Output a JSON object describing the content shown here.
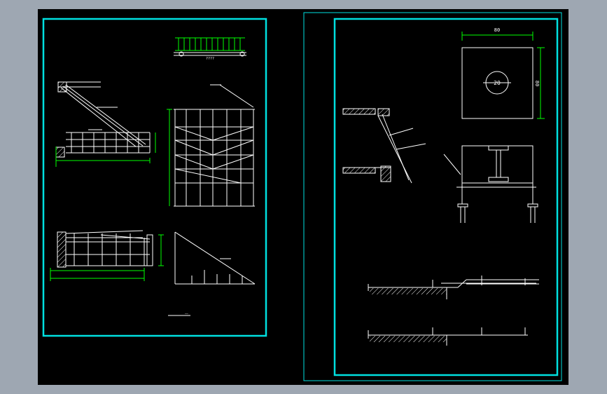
{
  "colors": {
    "background": "#9ea7b2",
    "canvas": "#000000",
    "frame": "#00e0e0",
    "line": "#ffffff",
    "dim": "#00ff00",
    "hatch": "#ffffff"
  },
  "sheet_right": {
    "plate": {
      "width_label": "80",
      "height_label": "80",
      "hole_label": "20"
    }
  },
  "sheet_left": {
    "top_beam_label": "????",
    "bottom_note": "——"
  }
}
